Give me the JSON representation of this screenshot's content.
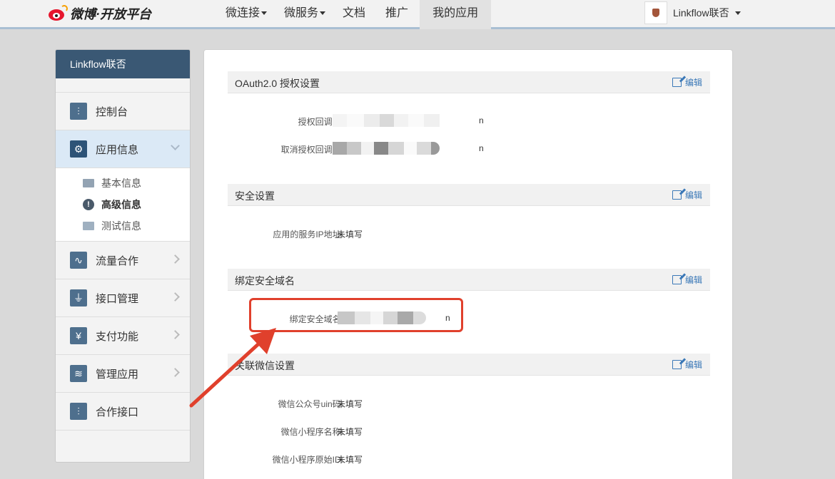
{
  "header": {
    "logo_text": "微博·开放平台",
    "nav": [
      {
        "label": "微连接",
        "dropdown": true
      },
      {
        "label": "微服务",
        "dropdown": true
      },
      {
        "label": "文档",
        "dropdown": false
      },
      {
        "label": "推广",
        "dropdown": false
      },
      {
        "label": "我的应用",
        "dropdown": false,
        "active": true
      }
    ],
    "user_name": "Linkflow联否"
  },
  "sidebar": {
    "title": "Linkflow联否",
    "items": [
      {
        "label": "控制台",
        "icon": "sliders-icon"
      },
      {
        "label": "应用信息",
        "icon": "gear-icon",
        "active": true,
        "expanded": true
      },
      {
        "label": "流量合作",
        "icon": "line-chart-icon"
      },
      {
        "label": "接口管理",
        "icon": "plug-icon"
      },
      {
        "label": "支付功能",
        "icon": "yen-icon"
      },
      {
        "label": "管理应用",
        "icon": "layers-icon"
      },
      {
        "label": "合作接口",
        "icon": "sliders-icon"
      }
    ],
    "sub_items": [
      {
        "label": "基本信息",
        "icon": "card-icon"
      },
      {
        "label": "高级信息",
        "icon": "alert-icon",
        "active": true
      },
      {
        "label": "测试信息",
        "icon": "id-card-icon"
      }
    ]
  },
  "main": {
    "edit_label": "编辑",
    "sections": [
      {
        "title": "OAuth2.0 授权设置",
        "rows": [
          {
            "label": "授权回调页:",
            "value": "",
            "blurred": true,
            "tail": "n"
          },
          {
            "label": "取消授权回调页:",
            "value": "",
            "blurred": true,
            "tail": "n"
          }
        ]
      },
      {
        "title": "安全设置",
        "rows": [
          {
            "label": "应用的服务IP地址:",
            "value": "未填写"
          }
        ]
      },
      {
        "title": "绑定安全域名",
        "rows": [
          {
            "label": "绑定安全域名:",
            "value": "",
            "blurred": true,
            "tail": "n"
          }
        ]
      },
      {
        "title": "关联微信设置",
        "rows": [
          {
            "label": "微信公众号uin码:",
            "value": "未填写"
          },
          {
            "label": "微信小程序名称:",
            "value": "未填写"
          },
          {
            "label": "微信小程序原始ID:",
            "value": "未填写"
          }
        ]
      }
    ]
  },
  "colors": {
    "annotation": "#e0402c",
    "sidebar_header": "#3a5874",
    "link": "#3a78b7"
  }
}
